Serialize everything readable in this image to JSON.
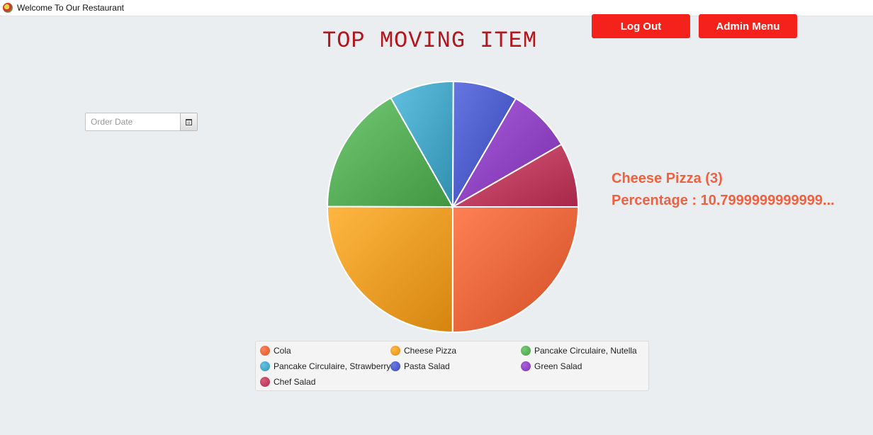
{
  "window": {
    "title": "Welcome To Our Restaurant",
    "icon": "restaurant-logo-icon"
  },
  "header": {
    "title": "TOP MOVING ITEM",
    "logout_label": "Log Out",
    "admin_label": "Admin Menu"
  },
  "filter": {
    "order_date_placeholder": "Order Date",
    "order_date_value": "",
    "calendar_icon": "calendar-icon"
  },
  "selected": {
    "name_line": "Cheese Pizza (3)",
    "percentage_line": "Percentage : 10.7999999999999..."
  },
  "colors": {
    "accent_button": "#f5221b",
    "title": "#b3161c",
    "info_text": "#f2603f",
    "background": "#ebeef0"
  },
  "chart_data": {
    "type": "pie",
    "legend_position": "bottom",
    "slices": [
      {
        "label": "Cola",
        "value": 25,
        "color": "#e8643a"
      },
      {
        "label": "Cheese Pizza",
        "value": 25,
        "color": "#eb9b25"
      },
      {
        "label": "Pancake Circulaire, Nutella",
        "value": 16.7,
        "color": "#57ad57"
      },
      {
        "label": "Pancake Circulaire, Strawberry",
        "value": 8.3,
        "color": "#46a4c4"
      },
      {
        "label": "Pasta Salad",
        "value": 8.3,
        "color": "#4a5ac7"
      },
      {
        "label": "Green Salad",
        "value": 8.3,
        "color": "#8d42c0"
      },
      {
        "label": "Chef Salad",
        "value": 8.3,
        "color": "#bd3d5f"
      }
    ]
  }
}
